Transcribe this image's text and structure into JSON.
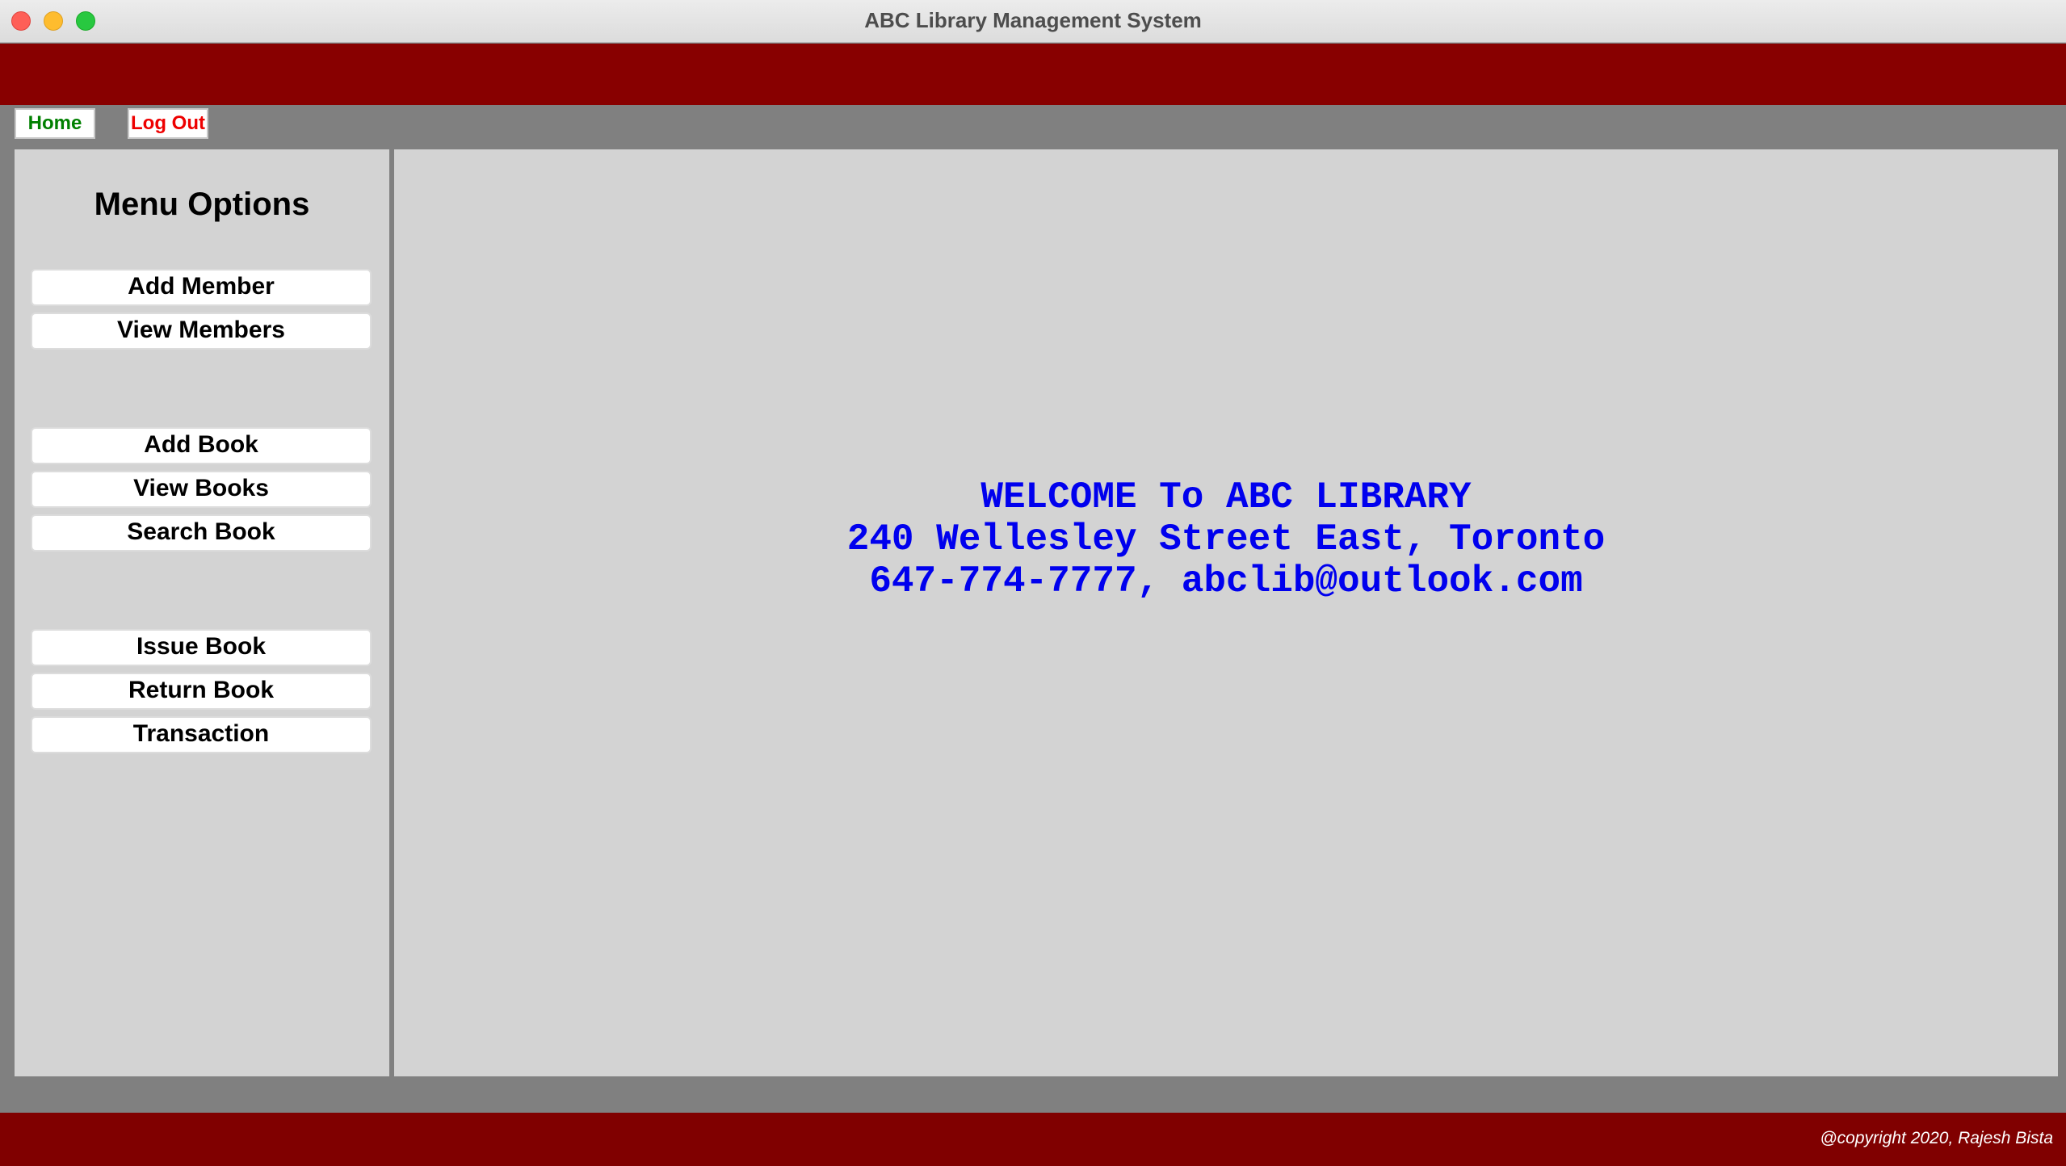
{
  "window": {
    "title": "ABC Library Management System"
  },
  "nav": {
    "home_label": "Home",
    "logout_label": "Log Out"
  },
  "sidebar": {
    "title": "Menu Options",
    "items": [
      {
        "label": "Add Member"
      },
      {
        "label": "View Members"
      },
      {
        "label": "Add Book"
      },
      {
        "label": "View Books"
      },
      {
        "label": "Search Book"
      },
      {
        "label": "Issue Book"
      },
      {
        "label": "Return Book"
      },
      {
        "label": "Transaction"
      }
    ]
  },
  "main": {
    "welcome_line1": "WELCOME To ABC LIBRARY",
    "welcome_line2": "240 Wellesley Street East, Toronto",
    "welcome_line3": "647-774-7777, abclib@outlook.com"
  },
  "footer": {
    "copyright": "@copyright 2020, Rajesh Bista"
  },
  "colors": {
    "header_band": "#880000",
    "footer_band": "#800000",
    "background": "#808080",
    "panel": "#d3d3d3",
    "welcome_text": "#0000ee",
    "home_text": "#008000",
    "logout_text": "#ee0000"
  }
}
